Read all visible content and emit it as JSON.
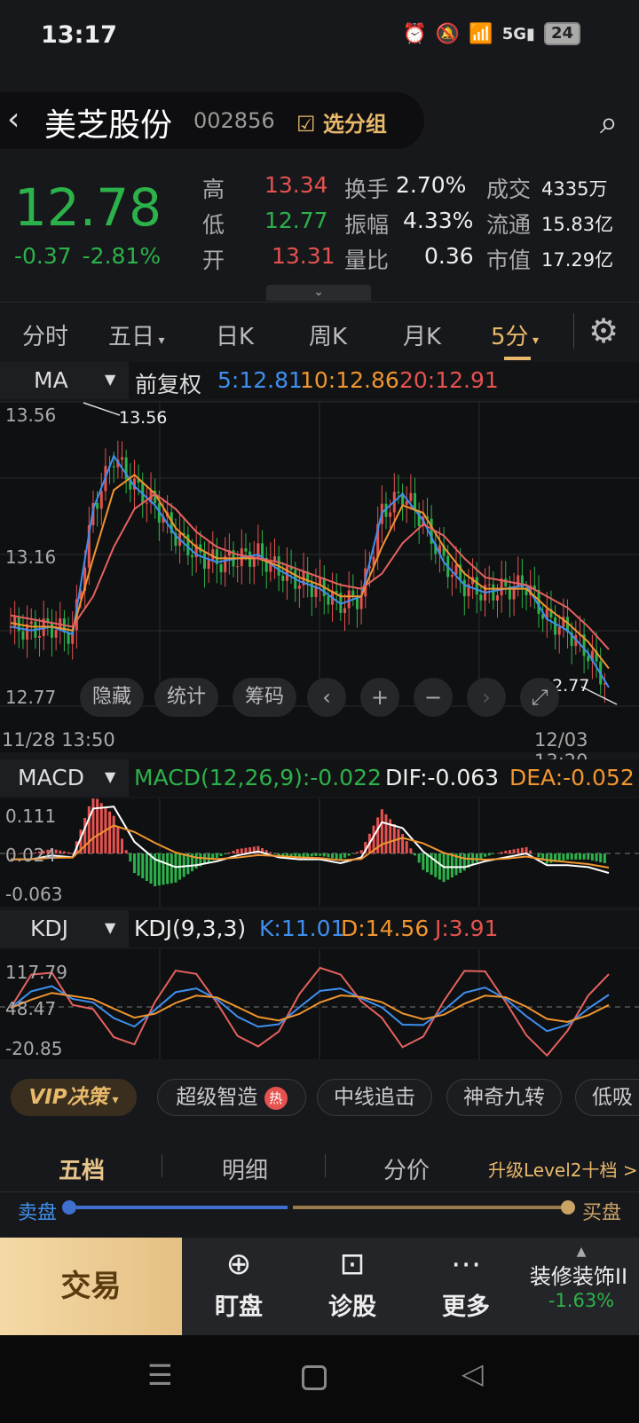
{
  "status": {
    "time": "13:17",
    "battery": "24"
  },
  "header": {
    "name": "美芝股份",
    "code": "002856",
    "group_label": "选分组",
    "price": "12.78",
    "change": "-0.37",
    "change_pct": "-2.81%",
    "quote": [
      {
        "l1": "高",
        "v1": "13.34",
        "l2": "换手",
        "v2": "2.70%",
        "l3": "成交",
        "v3": "4335万"
      },
      {
        "l1": "低",
        "v1": "12.77",
        "l2": "振幅",
        "v2": "4.33%",
        "l3": "流通",
        "v3": "15.83亿"
      },
      {
        "l1": "开",
        "v1": "13.31",
        "l2": "量比",
        "v2": "0.36",
        "l3": "市值",
        "v3": "17.29亿"
      }
    ]
  },
  "tabs": [
    "分时",
    "五日",
    "日K",
    "周K",
    "月K",
    "5分"
  ],
  "main_chart": {
    "indicator": "MA",
    "adjust": "前复权",
    "ma5": "5:12.81",
    "ma10": "10:12.86",
    "ma20": "20:12.91",
    "y_top": "13.56",
    "y_mid": "13.16",
    "y_bot": "12.77",
    "high_mark": "13.56",
    "low_mark": "12.77",
    "t_start": "11/28 13:50",
    "t_end": "12/03 13:20",
    "buttons": [
      "隐藏",
      "统计",
      "筹码"
    ]
  },
  "macd_chart": {
    "indicator": "MACD",
    "macd": "MACD(12,26,9):-0.022",
    "dif": "DIF:-0.063",
    "dea": "DEA:-0.052",
    "y_top": "0.111",
    "y_mid": "0.024",
    "y_bot": "-0.063"
  },
  "kdj_chart": {
    "indicator": "KDJ",
    "params": "KDJ(9,3,3)",
    "k": "K:11.01",
    "d": "D:14.56",
    "j": "J:3.91",
    "y_top": "117.79",
    "y_mid": "48.47",
    "y_bot": "-20.85"
  },
  "feature_pills": [
    "VIP决策",
    "超级智造",
    "中线追击",
    "神奇九转",
    "低吸"
  ],
  "hot_badge": "热",
  "levels": {
    "tabs": [
      "五档",
      "明细",
      "分价"
    ],
    "upgrade": "升级Level2十档 >",
    "sell": "卖盘",
    "buy": "买盘"
  },
  "bottom": {
    "trade": "交易",
    "items": [
      "盯盘",
      "诊股",
      "更多"
    ],
    "sector": "装修装饰II",
    "sector_change": "-1.63%"
  },
  "colors": {
    "up": "#e5524f",
    "down": "#2cb24a",
    "ma5": "#3f8fef",
    "ma10": "#f0952f",
    "ma20": "#e5625f",
    "accent": "#e8b96b"
  },
  "chart_data": {
    "type": "line",
    "title": "",
    "x_range": [
      "11/28 13:50",
      "12/03 13:20"
    ],
    "y_range": [
      12.77,
      13.56
    ],
    "x": [
      0,
      1,
      2,
      3,
      4,
      5,
      6,
      7,
      8,
      9,
      10,
      11,
      12,
      13,
      14,
      15,
      16,
      17,
      18,
      19,
      20,
      21,
      22,
      23,
      24,
      25,
      26,
      27,
      28,
      29
    ],
    "series": [
      {
        "name": "5:12.81",
        "values": [
          12.97,
          12.96,
          12.97,
          12.95,
          13.28,
          13.42,
          13.34,
          13.29,
          13.21,
          13.16,
          13.14,
          13.15,
          13.16,
          13.12,
          13.09,
          13.07,
          13.03,
          13.05,
          13.27,
          13.32,
          13.25,
          13.14,
          13.08,
          13.06,
          13.07,
          13.08,
          12.99,
          12.96,
          12.9,
          12.81
        ]
      },
      {
        "name": "10:12.86",
        "values": [
          12.98,
          12.97,
          12.97,
          12.96,
          13.15,
          13.33,
          13.37,
          13.32,
          13.23,
          13.18,
          13.15,
          13.15,
          13.15,
          13.13,
          13.1,
          13.08,
          13.05,
          13.05,
          13.18,
          13.29,
          13.27,
          13.18,
          13.11,
          13.07,
          13.07,
          13.07,
          13.02,
          12.98,
          12.93,
          12.86
        ]
      },
      {
        "name": "20:12.91",
        "values": [
          13.0,
          12.99,
          12.98,
          12.97,
          13.05,
          13.18,
          13.28,
          13.32,
          13.28,
          13.22,
          13.18,
          13.16,
          13.15,
          13.14,
          13.12,
          13.1,
          13.08,
          13.07,
          13.11,
          13.19,
          13.24,
          13.21,
          13.15,
          13.1,
          13.09,
          13.08,
          13.05,
          13.02,
          12.97,
          12.91
        ]
      }
    ]
  }
}
